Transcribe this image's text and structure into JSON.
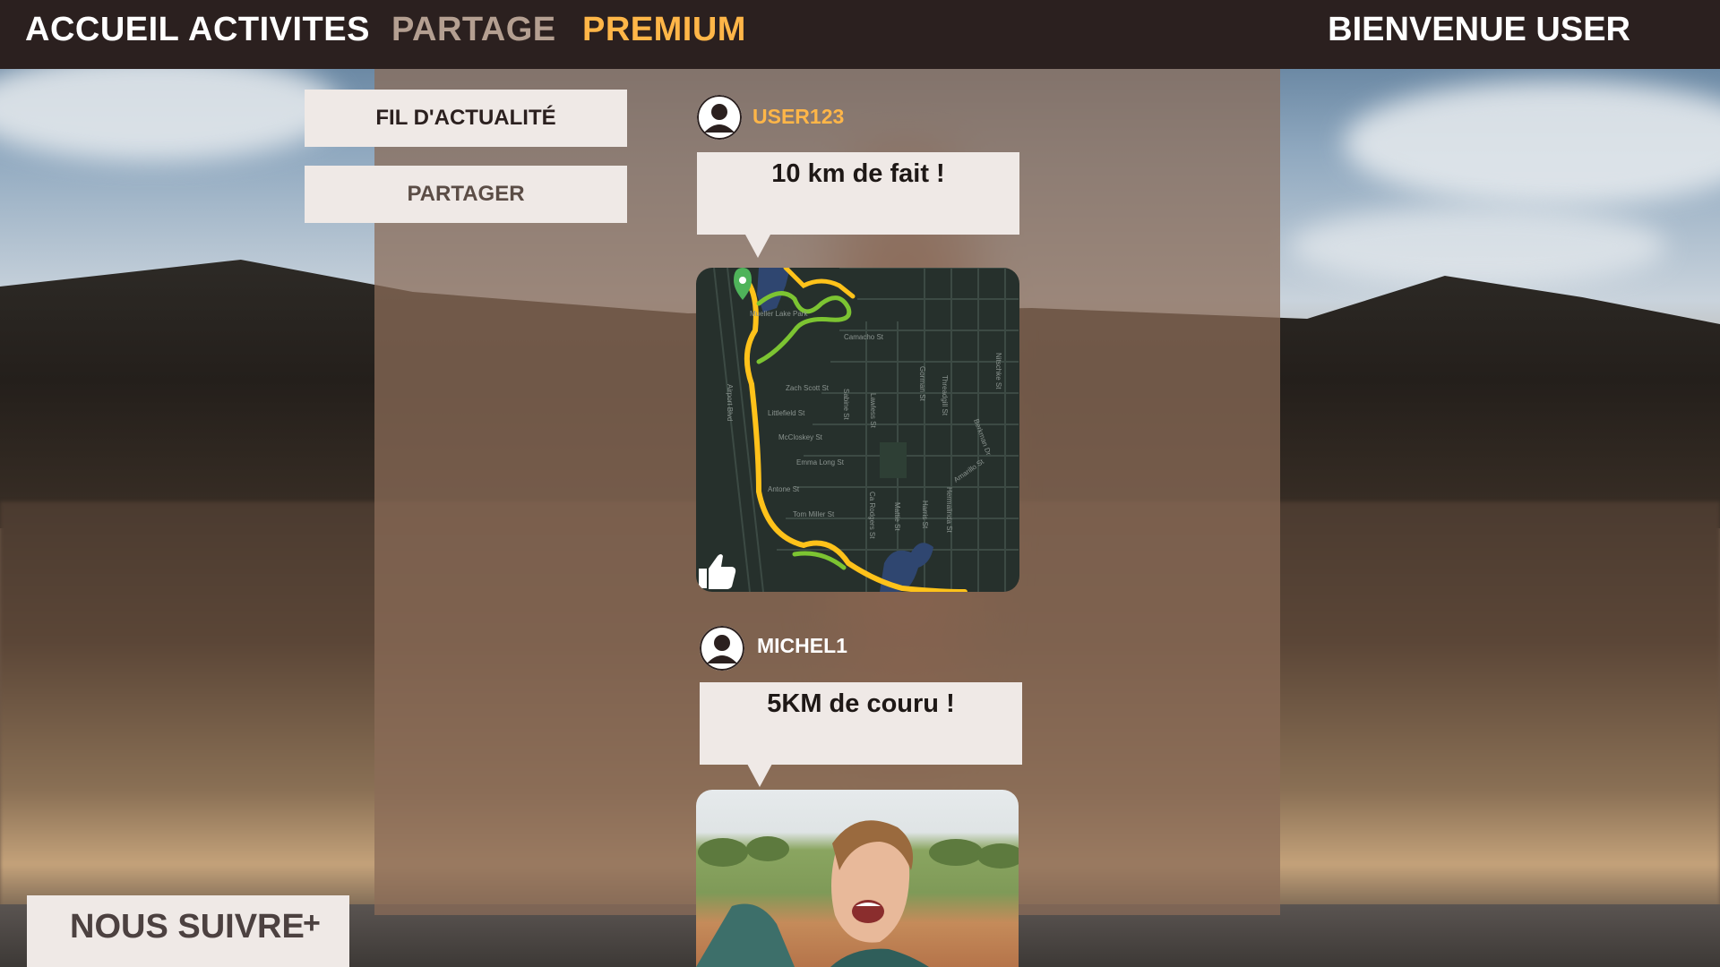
{
  "nav": {
    "items": [
      {
        "label": "ACCUEIL"
      },
      {
        "label": "ACTIVITES"
      },
      {
        "label": "PARTAGE"
      },
      {
        "label": "PREMIUM"
      }
    ],
    "welcome": "BIENVENUE USER",
    "colors": {
      "active": "#b49f91",
      "premium": "#ffb648",
      "bar": "#2b201f"
    }
  },
  "sidebar": {
    "buttons": [
      {
        "label": "FIL D'ACTUALITÉ"
      },
      {
        "label": "PARTAGER"
      }
    ]
  },
  "posts": [
    {
      "username": "USER123",
      "username_color": "#ffb648",
      "message": "10 km de fait !",
      "media": "map-route",
      "map_labels": [
        "Mueller Lake Park",
        "Camacho St",
        "Zach Scott St",
        "Littlefield St",
        "McCloskey St",
        "Emma Long St",
        "Antone St",
        "Tom Miller St",
        "Airport Blvd",
        "Berkman Dr",
        "Threadgill St",
        "Gorman St",
        "Sabine St",
        "Lawless St",
        "Hermalinda St",
        "Harris St",
        "Mattie St",
        "Ca Rodgers St",
        "Nitschke St",
        "Amarillo St"
      ],
      "icons": [
        "user-icon",
        "thumbs-up-icon",
        "map-pin-icon"
      ]
    },
    {
      "username": "MICHEL1",
      "username_color": "#ffffff",
      "message": "5KM de couru !",
      "media": "photo-runner",
      "icons": [
        "user-icon"
      ]
    }
  ],
  "footer": {
    "follow_label": "NOUS SUIVRE",
    "follow_plus": "+"
  }
}
